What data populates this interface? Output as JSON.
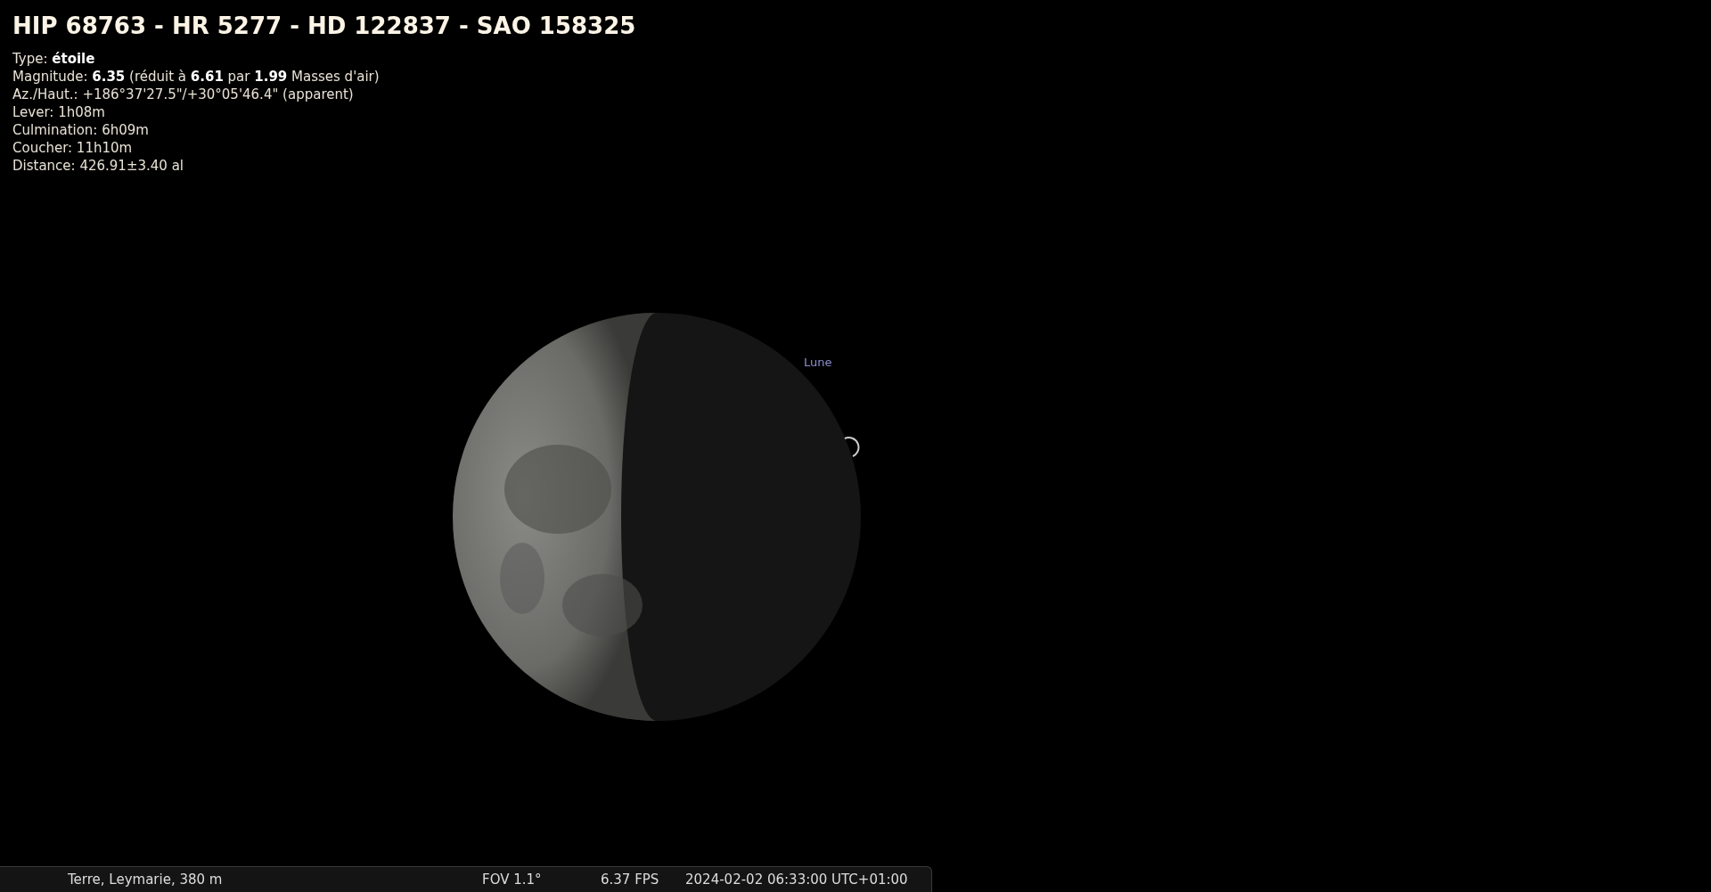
{
  "object": {
    "title": "HIP 68763 - HR 5277 - HD 122837 - SAO 158325",
    "info": [
      "Type: **étoile**",
      "Magnitude: **6.35** (réduit à **6.61** par **1.99** Masses d'air)",
      "Az./Haut.: +186°37'27.5\"/+30°05'46.4\" (apparent)",
      "Lever: 1h08m",
      "Culmination: 6h09m",
      "Coucher: 11h10m",
      "Distance: 426.91±3.40 al"
    ]
  },
  "sky": {
    "moon_label": "Lune"
  },
  "status_bar": {
    "location": "Terre, Leymarie, 380 m",
    "fov": "FOV 1.1°",
    "fps": "6.37 FPS",
    "datetime": "2024-02-02 06:33:00 UTC+01:00"
  }
}
